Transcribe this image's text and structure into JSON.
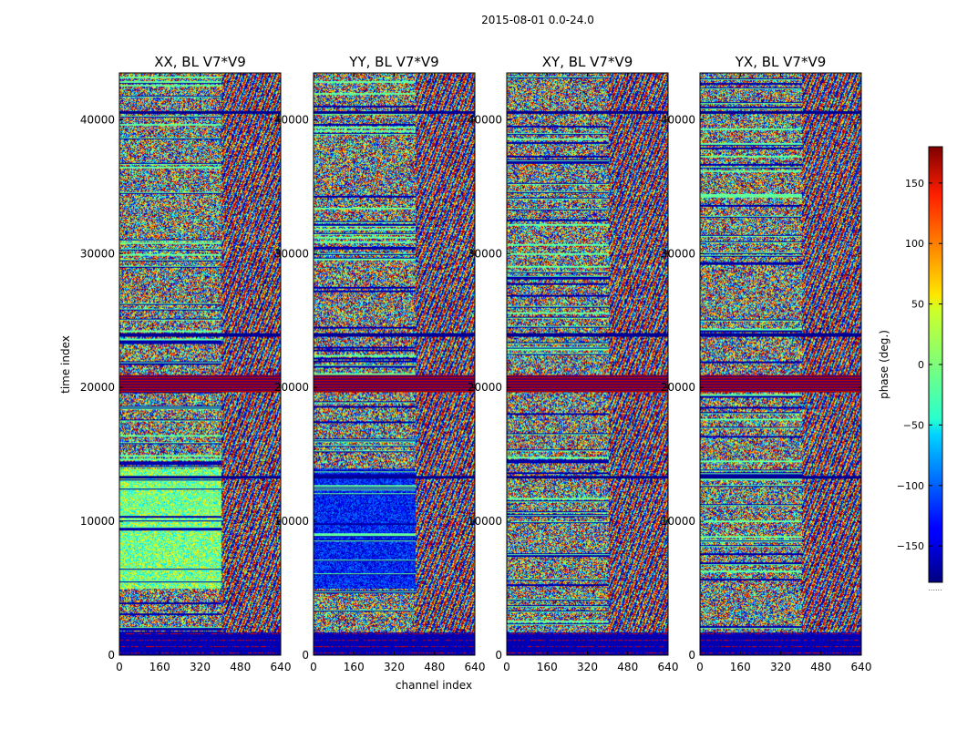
{
  "suptitle": "2015-08-01 0.0-24.0",
  "colormap": "jet",
  "chart_data": {
    "type": "heatmap",
    "xlabel": "channel index",
    "ylabel": "time index",
    "colorbar_label": "phase (deg.)",
    "xlim": [
      0,
      640
    ],
    "ylim": [
      0,
      43500
    ],
    "x_ticks": [
      0,
      160,
      320,
      480,
      640
    ],
    "y_ticks": [
      0,
      10000,
      20000,
      30000,
      40000
    ],
    "colorbar_range": [
      -180,
      180
    ],
    "colorbar_ticks": [
      -150,
      -100,
      -50,
      0,
      50,
      100,
      150
    ],
    "tick_labels": {
      "x": [
        "0",
        "160",
        "320",
        "480",
        "640"
      ],
      "y": [
        "0",
        "10000",
        "20000",
        "30000",
        "40000"
      ],
      "colorbar": [
        "−150",
        "−100",
        "−50",
        "0",
        "50",
        "100",
        "150"
      ]
    },
    "panels": [
      {
        "title": "XX, BL V7*V9"
      },
      {
        "title": "YY, BL V7*V9"
      },
      {
        "title": "XY, BL V7*V9"
      },
      {
        "title": "YX, BL V7*V9"
      }
    ]
  }
}
